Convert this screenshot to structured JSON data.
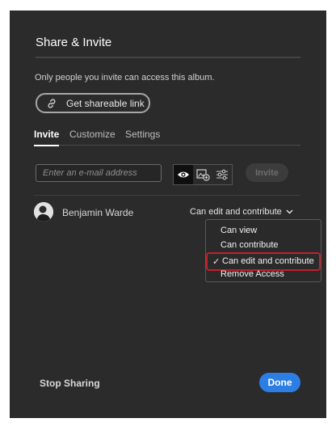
{
  "dialog": {
    "title": "Share & Invite",
    "subtitle": "Only people you invite can access this album.",
    "shareable_link_label": "Get shareable link"
  },
  "tabs": [
    {
      "label": "Invite",
      "active": true
    },
    {
      "label": "Customize",
      "active": false
    },
    {
      "label": "Settings",
      "active": false
    }
  ],
  "invite_form": {
    "email_placeholder": "Enter an e-mail address",
    "email_value": "",
    "permission_icons": [
      "eye-icon",
      "add-photo-icon",
      "sliders-icon"
    ],
    "selected_permission": "eye-icon",
    "invite_label": "Invite"
  },
  "members": [
    {
      "name": "Benjamin Warde",
      "access": "Can edit and contribute"
    }
  ],
  "access_menu": {
    "options": [
      "Can view",
      "Can contribute",
      "Can edit and contribute",
      "Remove Access"
    ],
    "selected_index": 2,
    "check_mark": "✓"
  },
  "footer": {
    "stop_sharing_label": "Stop Sharing",
    "done_label": "Done"
  },
  "colors": {
    "dialog_background": "#2b2b2b",
    "primary_button": "#2d7ee4",
    "highlight_outline": "#c21f2b"
  }
}
